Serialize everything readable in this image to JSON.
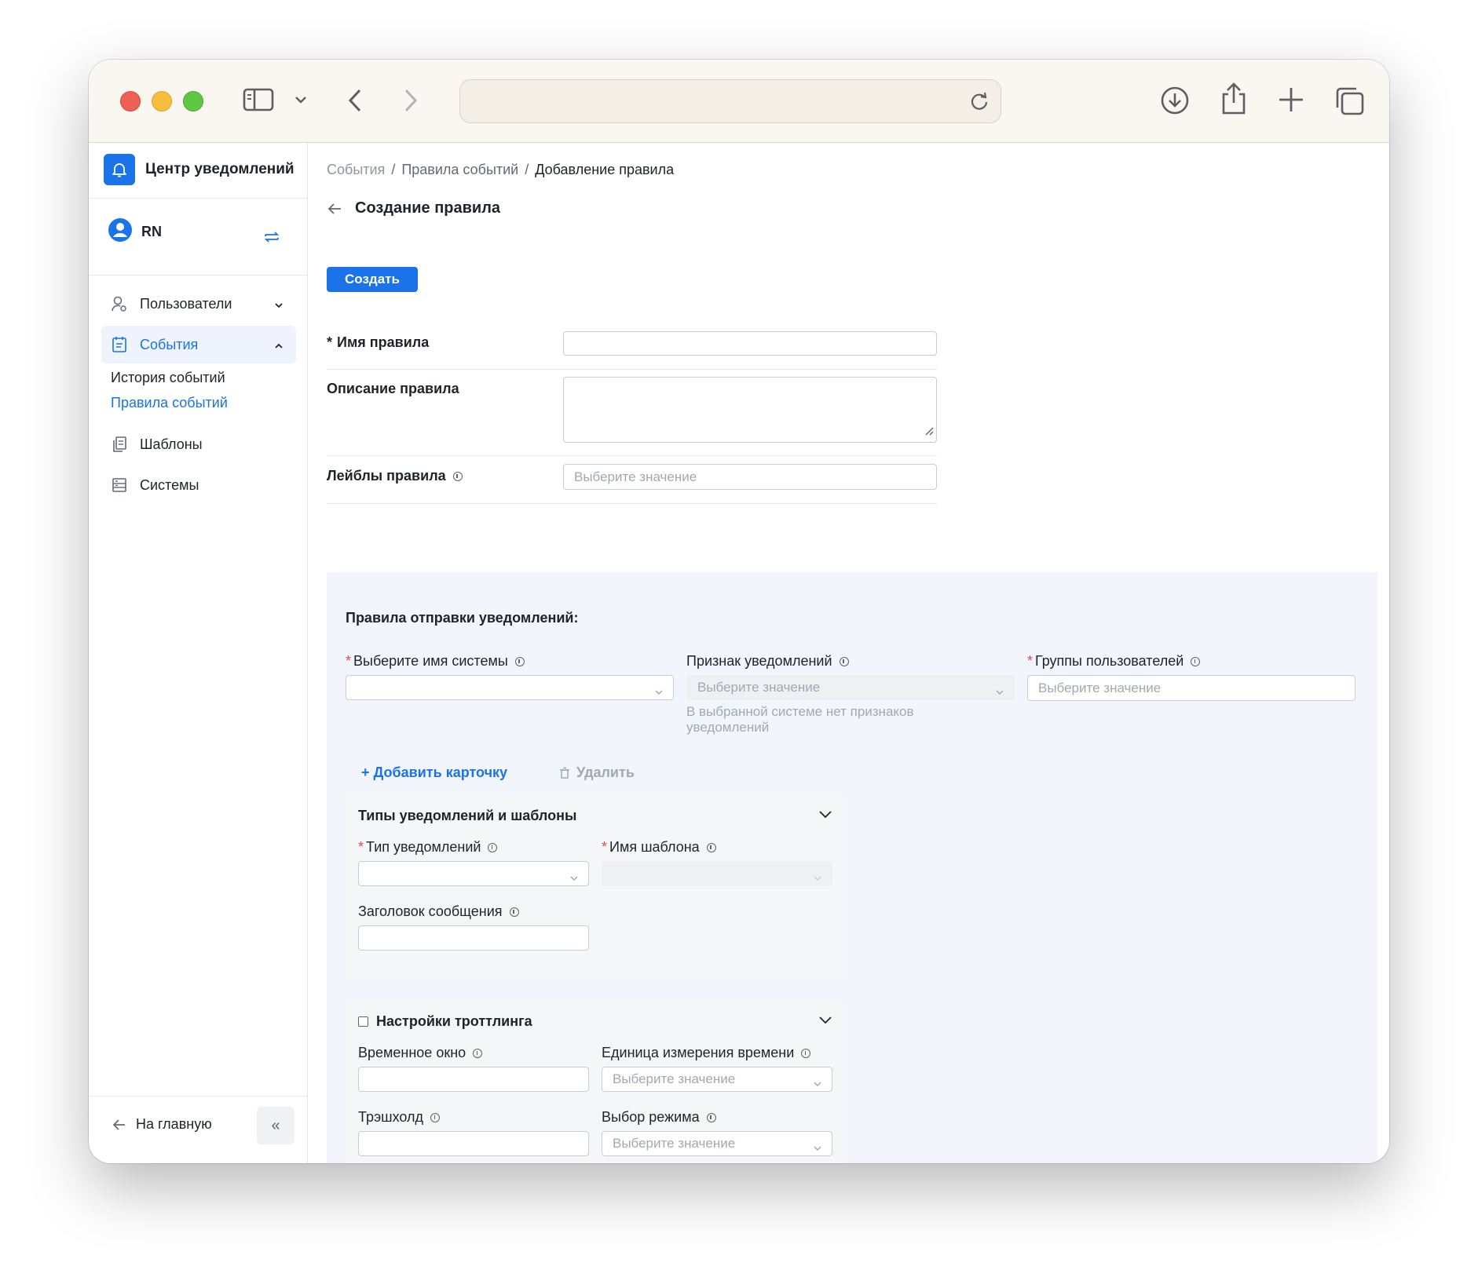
{
  "app": {
    "title": "Центр уведомлений"
  },
  "user": {
    "initials": "RN"
  },
  "sidebar": {
    "items": [
      {
        "label": "Пользователи"
      },
      {
        "label": "События"
      },
      {
        "label": "Шаблоны"
      },
      {
        "label": "Системы"
      }
    ],
    "subitems": [
      {
        "label": "История событий"
      },
      {
        "label": "Правила событий"
      }
    ],
    "home_label": "На главную",
    "collapse_label": "«"
  },
  "breadcrumb": {
    "items": [
      "События",
      "Правила событий",
      "Добавление правила"
    ],
    "separator": "/"
  },
  "page": {
    "title": "Создание правила",
    "create_button": "Создать"
  },
  "form": {
    "required_mark": "*",
    "rule_name_label": "Имя правила",
    "description_label": "Описание правила",
    "labels_label": "Лейблы правила",
    "labels_placeholder": "Выберите значение"
  },
  "rules_panel": {
    "title": "Правила отправки уведомлений:",
    "system_name_label": "Выберите имя системы",
    "notification_attr_label": "Признак уведомлений",
    "notification_attr_placeholder": "Выберите значение",
    "notification_attr_hint": "В выбранной системе нет признаков уведомлений",
    "user_groups_label": "Группы пользователей",
    "user_groups_placeholder": "Выберите значение",
    "add_card_label": "+ Добавить карточку",
    "delete_label": "Удалить"
  },
  "types_card": {
    "title": "Типы уведомлений и шаблоны",
    "notification_type_label": "Тип уведомлений",
    "template_name_label": "Имя шаблона",
    "message_title_label": "Заголовок сообщения"
  },
  "throttling_card": {
    "title": "Настройки троттлинга",
    "time_window_label": "Временное окно",
    "time_unit_label": "Единица измерения времени",
    "time_unit_placeholder": "Выберите значение",
    "threshold_label": "Трэшхолд",
    "mode_label": "Выбор режима",
    "mode_placeholder": "Выберите значение"
  },
  "colors": {
    "accent": "#1a73e8",
    "panel_bg": "#f2f5fc",
    "required": "#e5484d"
  }
}
